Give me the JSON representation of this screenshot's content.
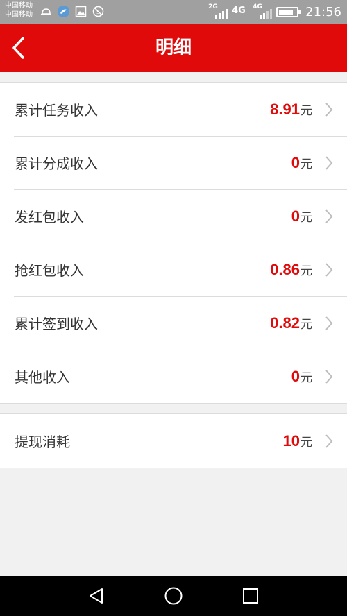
{
  "status_bar": {
    "carrier_1": "中国移动",
    "carrier_2": "中国移动",
    "net_1": "2G",
    "net_2_big": "4G",
    "net_2_small": "4G",
    "battery_level": 0.85,
    "time": "21:56"
  },
  "header": {
    "title": "明细"
  },
  "income_rows": [
    {
      "label": "累计任务收入",
      "amount": "8.91",
      "unit": "元"
    },
    {
      "label": "累计分成收入",
      "amount": "0",
      "unit": "元"
    },
    {
      "label": "发红包收入",
      "amount": "0",
      "unit": "元"
    },
    {
      "label": "抢红包收入",
      "amount": "0.86",
      "unit": "元"
    },
    {
      "label": "累计签到收入",
      "amount": "0.82",
      "unit": "元"
    },
    {
      "label": "其他收入",
      "amount": "0",
      "unit": "元"
    }
  ],
  "withdraw_row": {
    "label": "提现消耗",
    "amount": "10",
    "unit": "元"
  },
  "colors": {
    "accent": "#e10a0a",
    "background": "#f1f1f1",
    "status_bar": "#a0a0a0"
  }
}
